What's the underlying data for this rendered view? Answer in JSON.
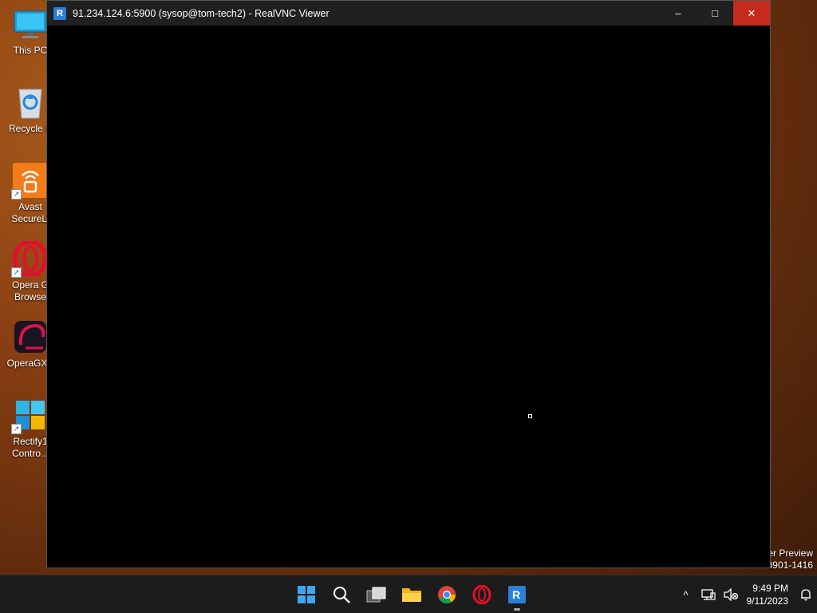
{
  "desktop": {
    "icons": [
      {
        "label": "This PC",
        "icon": "monitor-icon"
      },
      {
        "label": "Recycle B",
        "icon": "recycle-bin-icon"
      },
      {
        "label": "Avast SecureLi",
        "icon": "avast-securelin-icon"
      },
      {
        "label": "Opera G Browse",
        "icon": "opera-gx-icon"
      },
      {
        "label": "OperaGXS",
        "icon": "opera-gx-setup-icon"
      },
      {
        "label": "Rectify1 Contro...",
        "icon": "rectify11-icon"
      }
    ],
    "watermark_line1": "er Preview",
    "watermark_line2": "0901-1416"
  },
  "window": {
    "title": "91.234.124.6:5900 (sysop@tom-tech2) - RealVNC Viewer",
    "app_icon_text": "R",
    "minimize": "–",
    "maximize": "□",
    "close": "✕"
  },
  "taskbar": {
    "apps": [
      "start-icon",
      "search-icon",
      "task-view-icon",
      "file-explorer-icon",
      "chrome-icon",
      "opera-icon",
      "realvnc-icon"
    ],
    "tray": {
      "chevron": "^",
      "time": "9:49 PM",
      "date": "9/11/2023"
    }
  },
  "colors": {
    "close_button": "#c42b1c",
    "titlebar": "#202020",
    "taskbar": "#1c1c1c",
    "vnc_blue": "#2a7fd6"
  }
}
